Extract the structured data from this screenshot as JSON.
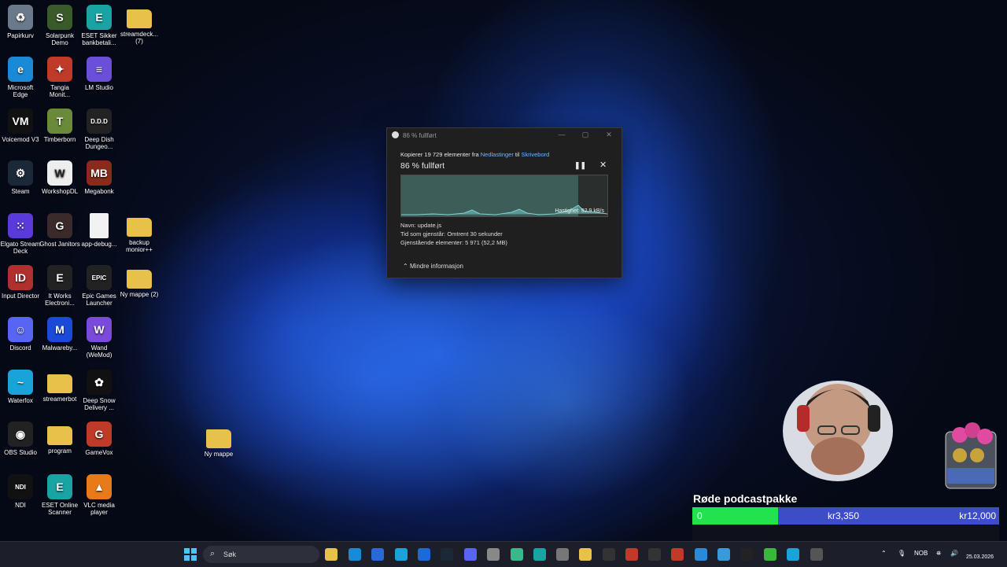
{
  "desktop_icons": [
    {
      "label": "Papirkurv",
      "icon": "recycle-bin-icon",
      "color": "#6a7a8a",
      "glyph": "♻"
    },
    {
      "label": "Solarpunk Demo",
      "icon": "solarpunk-icon",
      "color": "#3a5a2a",
      "glyph": "S"
    },
    {
      "label": "ESET Sikker bankbetali...",
      "icon": "eset-icon",
      "color": "#1aa3a3",
      "glyph": "E"
    },
    {
      "label": "streamdeck... (7)",
      "icon": "folder-icon",
      "color": "#e8c14a",
      "glyph": ""
    },
    {
      "label": "Microsoft Edge",
      "icon": "edge-icon",
      "color": "#1b8ad6",
      "glyph": "e"
    },
    {
      "label": "Tangia Monit...",
      "icon": "tangia-icon",
      "color": "#c03a2a",
      "glyph": "✦"
    },
    {
      "label": "LM Studio",
      "icon": "lm-studio-icon",
      "color": "#6b4fd8",
      "glyph": "≡"
    },
    {
      "label": "Voicemod V3",
      "icon": "voicemod-icon",
      "color": "#111",
      "glyph": "VM"
    },
    {
      "label": "Timberborn",
      "icon": "timberborn-icon",
      "color": "#6a8a3a",
      "glyph": "T"
    },
    {
      "label": "Deep Dish Dungeo...",
      "icon": "deep-dish-icon",
      "color": "#222",
      "glyph": "D.D.D"
    },
    {
      "label": "Steam",
      "icon": "steam-icon",
      "color": "#1b2838",
      "glyph": "⚙"
    },
    {
      "label": "WorkshopDL",
      "icon": "workshopdl-icon",
      "color": "#eee",
      "glyph": "W"
    },
    {
      "label": "Megabonk",
      "icon": "megabonk-icon",
      "color": "#8a2a1a",
      "glyph": "MB"
    },
    {
      "label": "Elgato Stream Deck",
      "icon": "stream-deck-icon",
      "color": "#5a3ad8",
      "glyph": "⁙"
    },
    {
      "label": "Ghost Janitors",
      "icon": "ghost-janitors-icon",
      "color": "#3a2a2a",
      "glyph": "G"
    },
    {
      "label": "app-debug...",
      "icon": "file-icon",
      "color": "#f2f2f2",
      "glyph": ""
    },
    {
      "label": "backup monior++",
      "icon": "folder-icon",
      "color": "#e8c14a",
      "glyph": ""
    },
    {
      "label": "Input Director",
      "icon": "input-director-icon",
      "color": "#b03030",
      "glyph": "ID"
    },
    {
      "label": "It Works Electroni...",
      "icon": "it-works-icon",
      "color": "#222",
      "glyph": "E"
    },
    {
      "label": "Epic Games Launcher",
      "icon": "epic-games-icon",
      "color": "#222",
      "glyph": "EPIC"
    },
    {
      "label": "Ny mappe (2)",
      "icon": "folder-icon",
      "color": "#e8c14a",
      "glyph": ""
    },
    {
      "label": "Discord",
      "icon": "discord-icon",
      "color": "#5865f2",
      "glyph": "☺"
    },
    {
      "label": "Malwareby...",
      "icon": "malwarebytes-icon",
      "color": "#1a4ad8",
      "glyph": "M"
    },
    {
      "label": "Wand (WeMod)",
      "icon": "wand-icon",
      "color": "#7a4ad8",
      "glyph": "W"
    },
    {
      "label": "Waterfox",
      "icon": "waterfox-icon",
      "color": "#1aa3d8",
      "glyph": "~"
    },
    {
      "label": "streamerbot",
      "icon": "folder-icon",
      "color": "#e8c14a",
      "glyph": ""
    },
    {
      "label": "Deep Snow Delivery ...",
      "icon": "deep-snow-icon",
      "color": "#111",
      "glyph": "✿"
    },
    {
      "label": "OBS Studio",
      "icon": "obs-icon",
      "color": "#222",
      "glyph": "◉"
    },
    {
      "label": "program",
      "icon": "folder-icon",
      "color": "#e8c14a",
      "glyph": ""
    },
    {
      "label": "GameVox",
      "icon": "gamevox-icon",
      "color": "#c03a2a",
      "glyph": "G"
    },
    {
      "label": "NDI",
      "icon": "ndi-icon",
      "color": "#111",
      "glyph": "NDI"
    },
    {
      "label": "ESET Online Scanner",
      "icon": "eset-scanner-icon",
      "color": "#1aa3a3",
      "glyph": "E"
    },
    {
      "label": "VLC media player",
      "icon": "vlc-icon",
      "color": "#e87a1a",
      "glyph": "▲"
    },
    {
      "label": "Ny mappe",
      "icon": "folder-icon",
      "color": "#e8c14a",
      "glyph": ""
    }
  ],
  "dialog": {
    "title": "86 % fullført",
    "copy_prefix": "Kopierer 19 729 elementer fra ",
    "from": "Nedlastinger",
    "to_word": " til ",
    "to": "Skrivebord",
    "percent_label": "86 % fullført",
    "progress": 0.86,
    "speed": "Hastighet: 92,9 kB/s",
    "name": "Navn: update.js",
    "time_left": "Tid som gjenstår: Omtrent 30 sekunder",
    "remaining": "Gjenstående elementer: 5 971 (52,2 MB)",
    "less_info": "Mindre informasjon"
  },
  "taskbar": {
    "search_placeholder": "Søk",
    "language": "NOB",
    "date": "25.03.2026"
  },
  "donation": {
    "title": "Røde podcastpakke",
    "current": "0",
    "milestone": "kr3,350",
    "goal": "kr12,000",
    "progress": 0.28
  }
}
